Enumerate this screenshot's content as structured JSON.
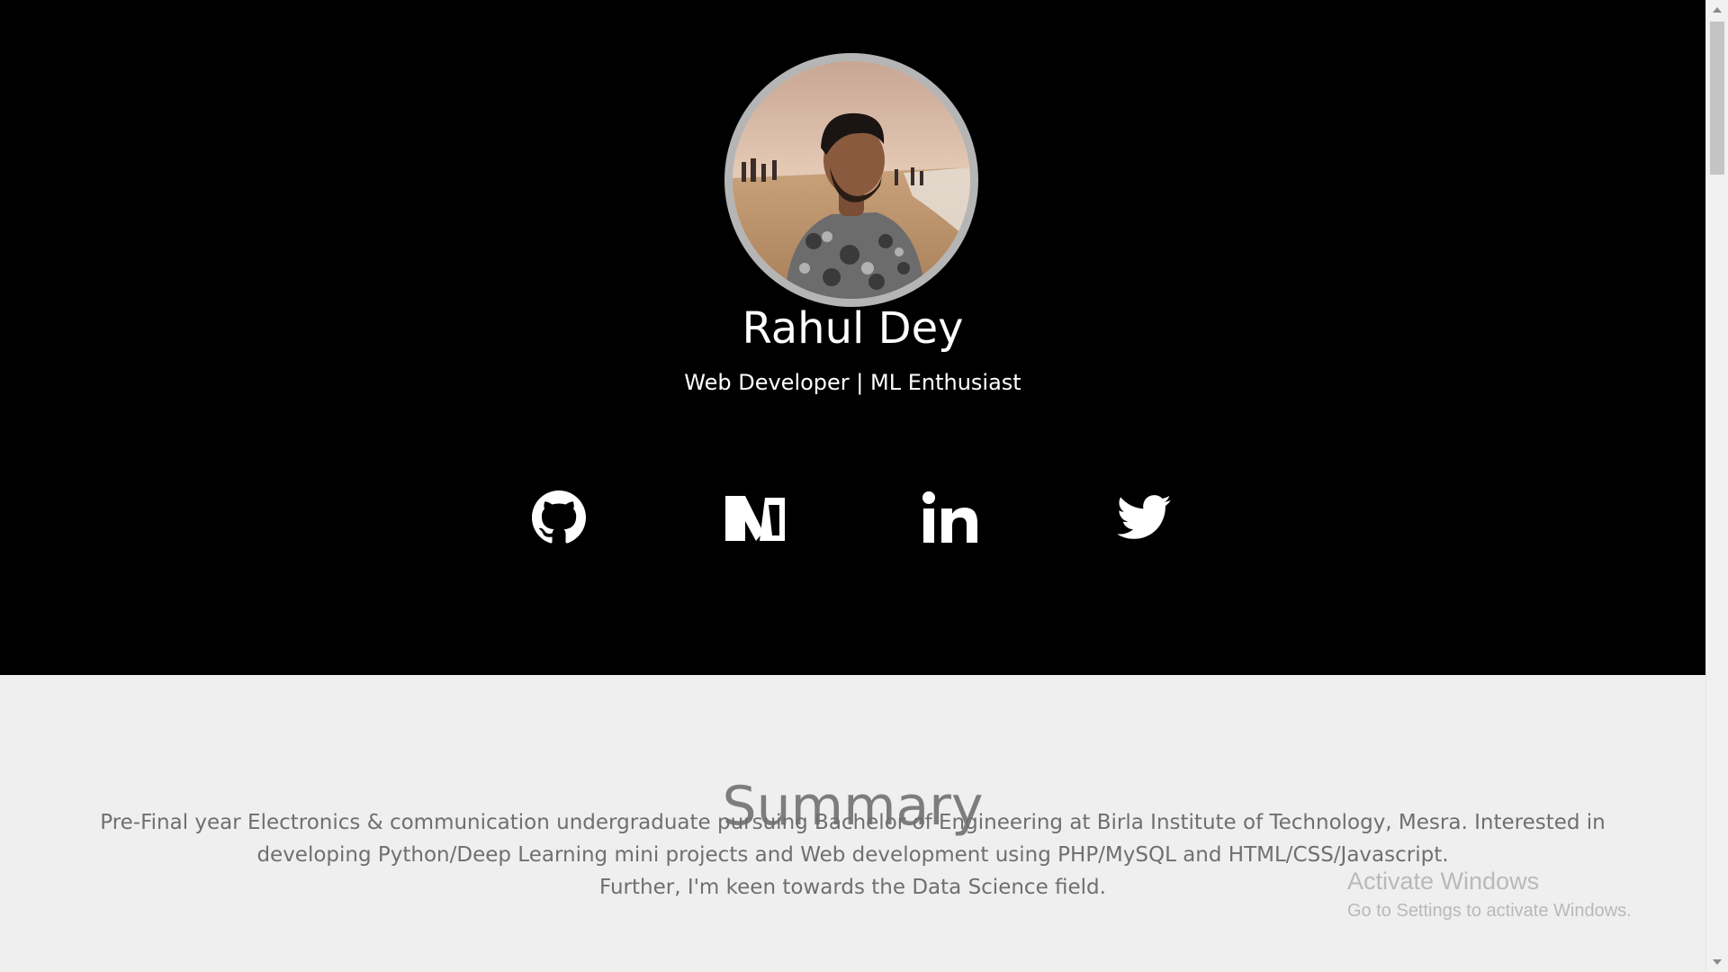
{
  "profile": {
    "name": "Rahul Dey",
    "tagline": "Web Developer | ML Enthusiast"
  },
  "social": [
    {
      "icon": "github-icon"
    },
    {
      "icon": "medium-icon"
    },
    {
      "icon": "linkedin-icon"
    },
    {
      "icon": "twitter-icon"
    }
  ],
  "summary": {
    "title": "Summary",
    "line1": "Pre-Final year Electronics & communication undergraduate pursuing Bachelor of Engineering at Birla Institute of Technology, Mesra. Interested in",
    "line2": "developing Python/Deep Learning mini projects and Web development using PHP/MySQL and HTML/CSS/Javascript.",
    "line3": "Further, I'm keen towards the Data Science field."
  },
  "watermark": {
    "line1": "Activate Windows",
    "line2": "Go to Settings to activate Windows."
  },
  "colors": {
    "hero_bg": "#000000",
    "page_bg": "#efefef",
    "summary_title": "#7d7d7d",
    "summary_text": "#6f6f6f"
  }
}
